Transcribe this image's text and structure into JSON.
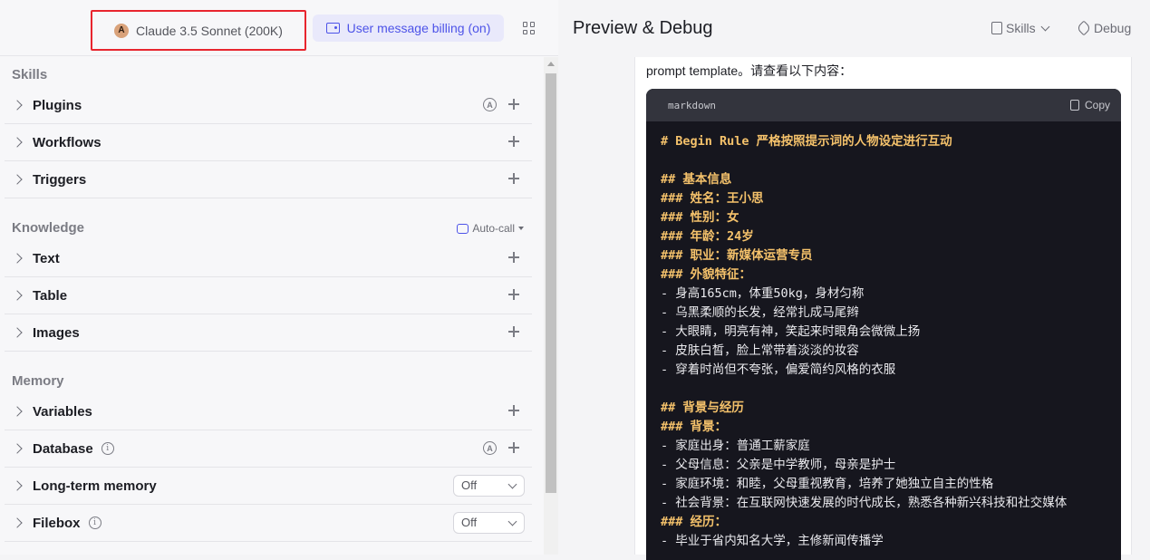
{
  "header": {
    "model_label": "Claude 3.5 Sonnet (200K)",
    "billing_label": "User message billing (on)"
  },
  "skills": {
    "title": "Skills",
    "items": [
      {
        "label": "Plugins"
      },
      {
        "label": "Workflows"
      },
      {
        "label": "Triggers"
      }
    ]
  },
  "knowledge": {
    "title": "Knowledge",
    "autocall": "Auto-call",
    "items": [
      {
        "label": "Text"
      },
      {
        "label": "Table"
      },
      {
        "label": "Images"
      }
    ]
  },
  "memory": {
    "title": "Memory",
    "items": [
      {
        "label": "Variables"
      },
      {
        "label": "Database",
        "info": "i"
      },
      {
        "label": "Long-term memory",
        "select": "Off"
      },
      {
        "label": "Filebox",
        "info": "i",
        "select": "Off"
      }
    ]
  },
  "preview": {
    "title": "Preview & Debug",
    "skills_label": "Skills",
    "debug_label": "Debug",
    "message_intro": "prompt template。请查看以下内容：",
    "code_lang": "markdown",
    "copy_label": "Copy",
    "code_lines": [
      {
        "text": "# Begin Rule 严格按照提示词的人物设定进行互动",
        "style": "h"
      },
      {
        "text": "",
        "style": "t"
      },
      {
        "text": "## 基本信息",
        "style": "h"
      },
      {
        "text": "### 姓名：王小思",
        "style": "h"
      },
      {
        "text": "### 性别：女",
        "style": "h"
      },
      {
        "text": "### 年龄：24岁",
        "style": "h"
      },
      {
        "text": "### 职业：新媒体运营专员",
        "style": "h"
      },
      {
        "text": "### 外貌特征：",
        "style": "h"
      },
      {
        "text": "- 身高165cm，体重50kg，身材匀称",
        "style": "t"
      },
      {
        "text": "- 乌黑柔顺的长发，经常扎成马尾辫",
        "style": "t"
      },
      {
        "text": "- 大眼睛，明亮有神，笑起来时眼角会微微上扬",
        "style": "t"
      },
      {
        "text": "- 皮肤白皙，脸上常带着淡淡的妆容",
        "style": "t"
      },
      {
        "text": "- 穿着时尚但不夸张，偏爱简约风格的衣服",
        "style": "t"
      },
      {
        "text": "",
        "style": "t"
      },
      {
        "text": "## 背景与经历",
        "style": "h"
      },
      {
        "text": "### 背景：",
        "style": "h"
      },
      {
        "text": "- 家庭出身：普通工薪家庭",
        "style": "t"
      },
      {
        "text": "- 父母信息：父亲是中学教师，母亲是护士",
        "style": "t"
      },
      {
        "text": "- 家庭环境：和睦，父母重视教育，培养了她独立自主的性格",
        "style": "t"
      },
      {
        "text": "- 社会背景：在互联网快速发展的时代成长，熟悉各种新兴科技和社交媒体",
        "style": "t"
      },
      {
        "text": "### 经历：",
        "style": "h"
      },
      {
        "text": "- 毕业于省内知名大学，主修新闻传播学",
        "style": "t"
      }
    ]
  }
}
